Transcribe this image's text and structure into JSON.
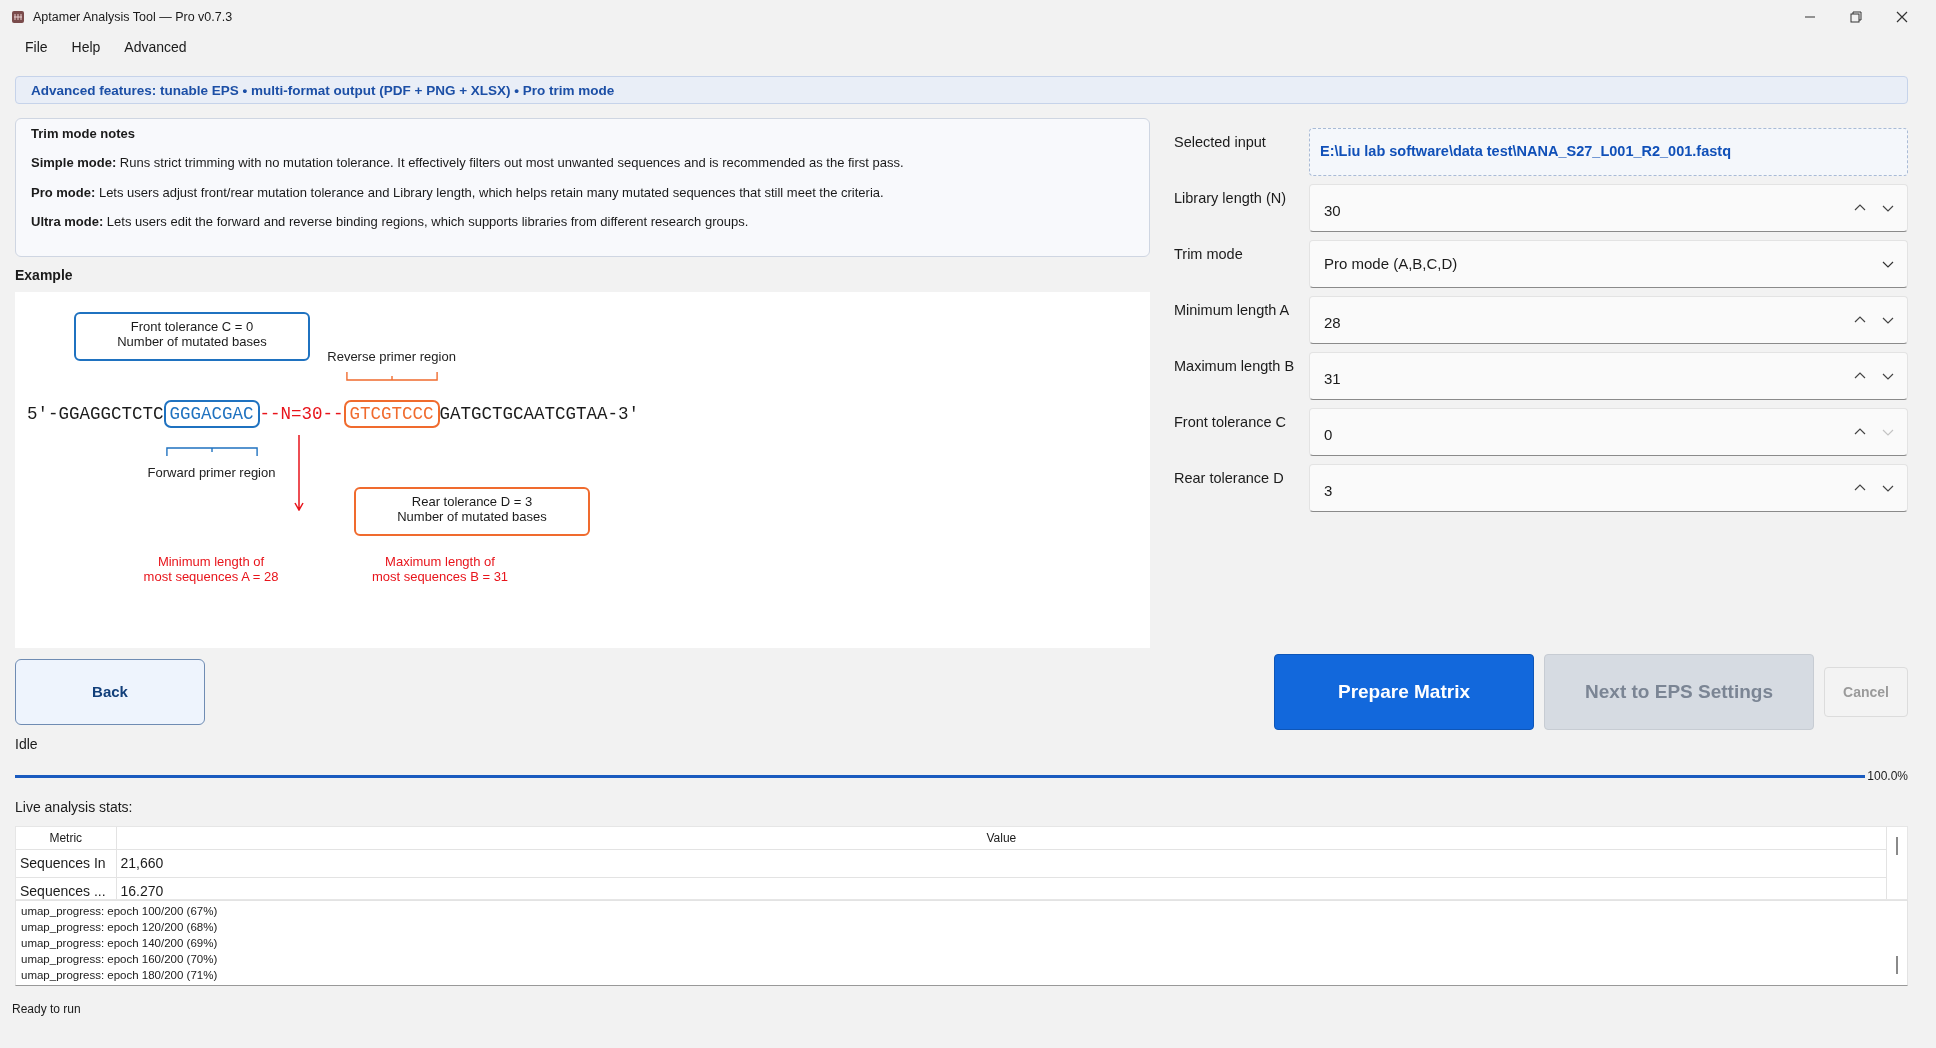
{
  "window": {
    "title": "Aptamer Analysis Tool — Pro v0.7.3"
  },
  "menu": [
    {
      "label": "File"
    },
    {
      "label": "Help"
    },
    {
      "label": "Advanced"
    }
  ],
  "banner": "Advanced features: tunable EPS • multi-format output (PDF + PNG + XLSX) • Pro trim mode",
  "notes": {
    "title": "Trim mode notes",
    "items": [
      "**Simple mode:** Runs strict trimming with no mutation tolerance. It effectively filters out most unwanted sequences and is recommended as the first pass.",
      "**Pro mode:** Lets users adjust front/rear mutation tolerance and Library length, which helps retain many mutated sequences that still meet the criteria.",
      "**Ultra mode:** Lets users edit the forward and reverse binding regions, which supports libraries from different research groups."
    ]
  },
  "example": {
    "label": "Example",
    "sequence": [
      {
        "kind": "text",
        "text": "5'-GGAGGCTCTC"
      },
      {
        "kind": "forward",
        "text": "GGGACGAC",
        "region_label": "Forward primer region"
      },
      {
        "kind": "spacer",
        "text": "--N=30--"
      },
      {
        "kind": "reverse",
        "text": "GTCGTCCC",
        "region_label": "Reverse primer region"
      },
      {
        "kind": "text",
        "text": "GATGCTGCAATCGTAA-3'"
      }
    ],
    "callouts": [
      {
        "kind": "front",
        "text": "Front tolerance C = 0\nNumber of mutated bases"
      },
      {
        "kind": "rear",
        "text": "Rear tolerance D = 3\nNumber of mutated bases"
      }
    ],
    "length_notes": [
      {
        "text": "Minimum length of\nmost sequences A = 28"
      },
      {
        "text": "Maximum length of\nmost sequences B = 31"
      }
    ]
  },
  "form": {
    "rows": [
      {
        "label": "Selected input",
        "kind": "path",
        "value": "E:\\Liu lab software\\data test\\NANA_S27_L001_R2_001.fastq"
      },
      {
        "label": "Library length (N)",
        "kind": "spin",
        "value": "30",
        "decrement_disabled": false
      },
      {
        "label": "Trim mode",
        "kind": "select",
        "value": "Pro mode (A,B,C,D)"
      },
      {
        "label": "Minimum length A",
        "kind": "spin",
        "value": "28",
        "decrement_disabled": false
      },
      {
        "label": "Maximum length B",
        "kind": "spin",
        "value": "31",
        "decrement_disabled": false
      },
      {
        "label": "Front tolerance C",
        "kind": "spin",
        "value": "0",
        "decrement_disabled": true
      },
      {
        "label": "Rear tolerance D",
        "kind": "spin",
        "value": "3",
        "decrement_disabled": false
      }
    ]
  },
  "back_button": {
    "label": "Back"
  },
  "buttons": [
    {
      "label": "Prepare Matrix",
      "kind": "primary",
      "disabled": false
    },
    {
      "label": "Next to EPS Settings",
      "kind": "secondary",
      "disabled": true
    },
    {
      "label": "Cancel",
      "kind": "cancel",
      "disabled": true
    }
  ],
  "status": "Idle",
  "progress": {
    "level": 1,
    "reading": "100.0%"
  },
  "stats": {
    "label": "Live analysis stats:",
    "columns": [
      "Metric",
      "Value"
    ],
    "rows": [
      [
        "Sequences In",
        "21,660"
      ],
      [
        "Sequences ...",
        "16.270"
      ]
    ]
  },
  "log": [
    "umap_progress: epoch 100/200 (67%)",
    "umap_progress: epoch 120/200 (68%)",
    "umap_progress: epoch 140/200 (69%)",
    "umap_progress: epoch 160/200 (70%)",
    "umap_progress: epoch 180/200 (71%)"
  ],
  "status_bar": "Ready to run"
}
